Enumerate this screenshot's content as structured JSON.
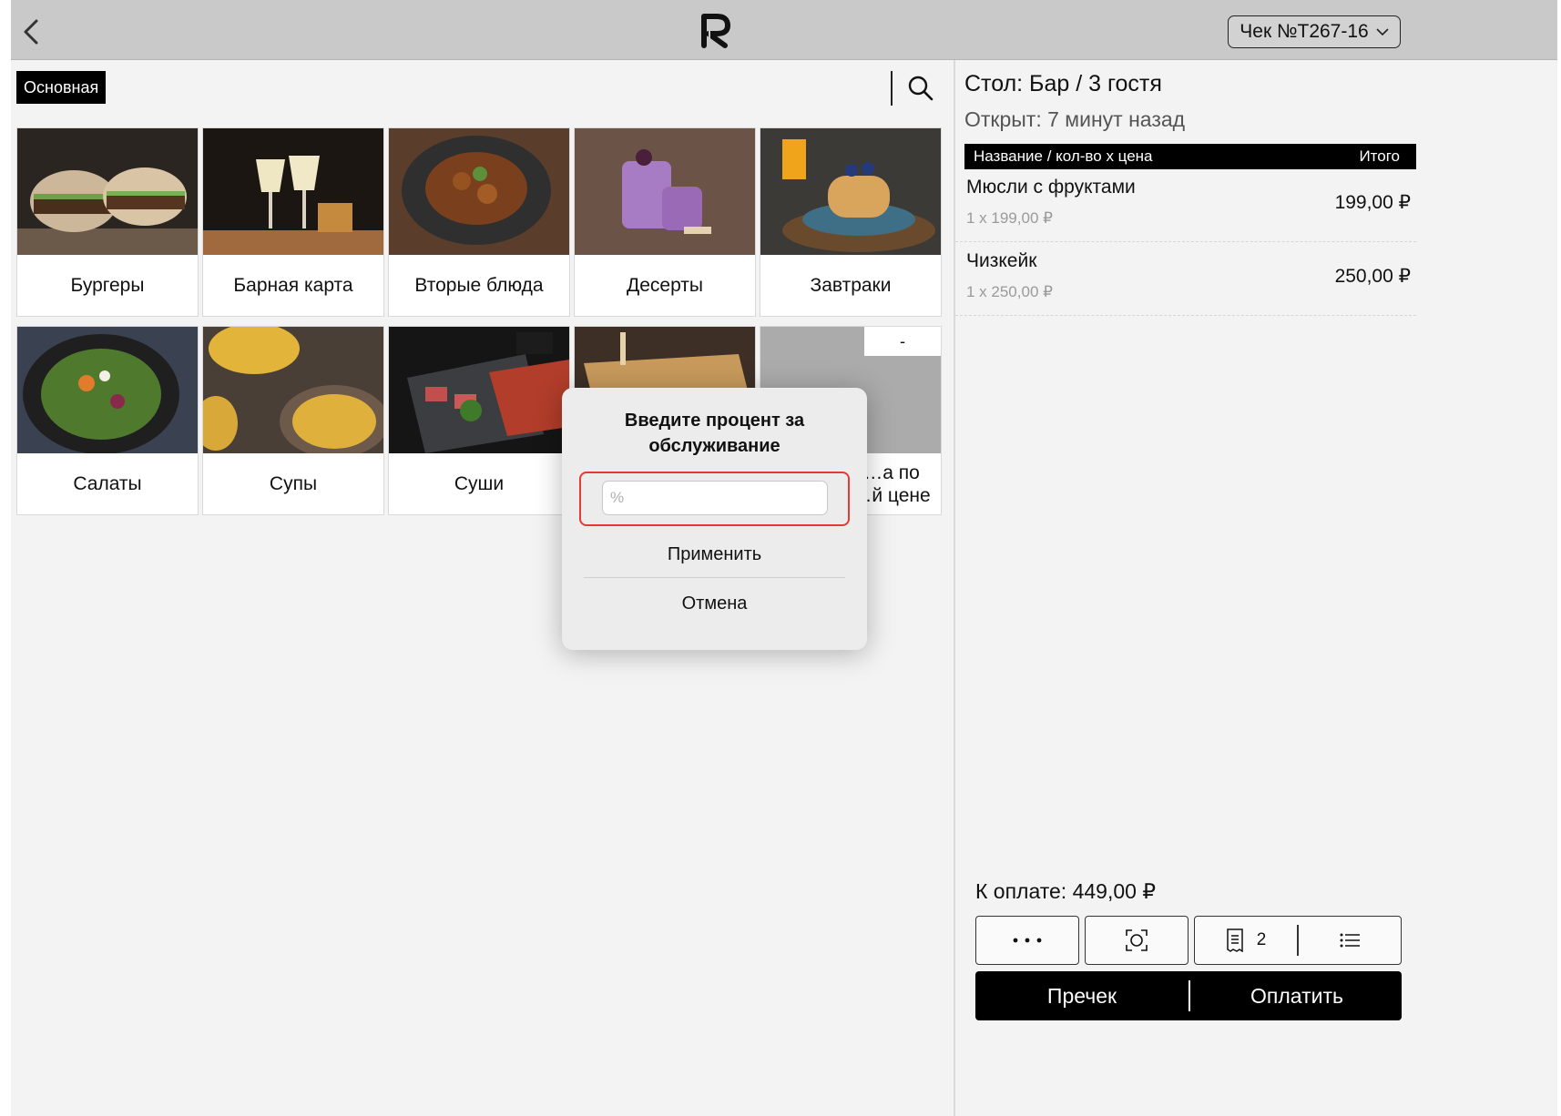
{
  "header": {
    "check_label": "Чек №T267-16"
  },
  "menu": {
    "active_tab": "Основная",
    "categories": [
      {
        "label": "Бургеры",
        "image": "burgers-photo"
      },
      {
        "label": "Барная карта",
        "image": "cocktails-photo"
      },
      {
        "label": "Вторые блюда",
        "image": "main-dish-photo"
      },
      {
        "label": "Десерты",
        "image": "desserts-photo"
      },
      {
        "label": "Завтраки",
        "image": "pancakes-photo"
      },
      {
        "label": "Салаты",
        "image": "salad-photo"
      },
      {
        "label": "Супы",
        "image": "soup-photo"
      },
      {
        "label": "Суши",
        "image": "sushi-photo"
      },
      {
        "label": "",
        "image": "sandwich-photo"
      },
      {
        "label_line1": "…а по",
        "label_line2": "…й цене",
        "badge": "-",
        "image": "placeholder-gray"
      }
    ]
  },
  "order": {
    "table": "Стол: Бар / 3 гостя",
    "opened": "Открыт: 7 минут назад",
    "col_name": "Название / кол-во х цена",
    "col_total": "Итого",
    "items": [
      {
        "name": "Мюсли с фруктами",
        "qty_price": "1 x 199,00 ₽",
        "total": "199,00 ₽"
      },
      {
        "name": "Чизкейк",
        "qty_price": "1 x 250,00 ₽",
        "total": "250,00 ₽"
      }
    ],
    "to_pay": "К оплате: 449,00 ₽",
    "receipts_count": "2",
    "precheck_label": "Пречек",
    "pay_label": "Оплатить"
  },
  "modal": {
    "title": "Введите процент за обслуживание",
    "input_placeholder": "%",
    "apply_label": "Применить",
    "cancel_label": "Отмена"
  },
  "colors": {
    "topbar": "#c9c9c9",
    "highlight": "#e53935",
    "primary": "#000000"
  }
}
